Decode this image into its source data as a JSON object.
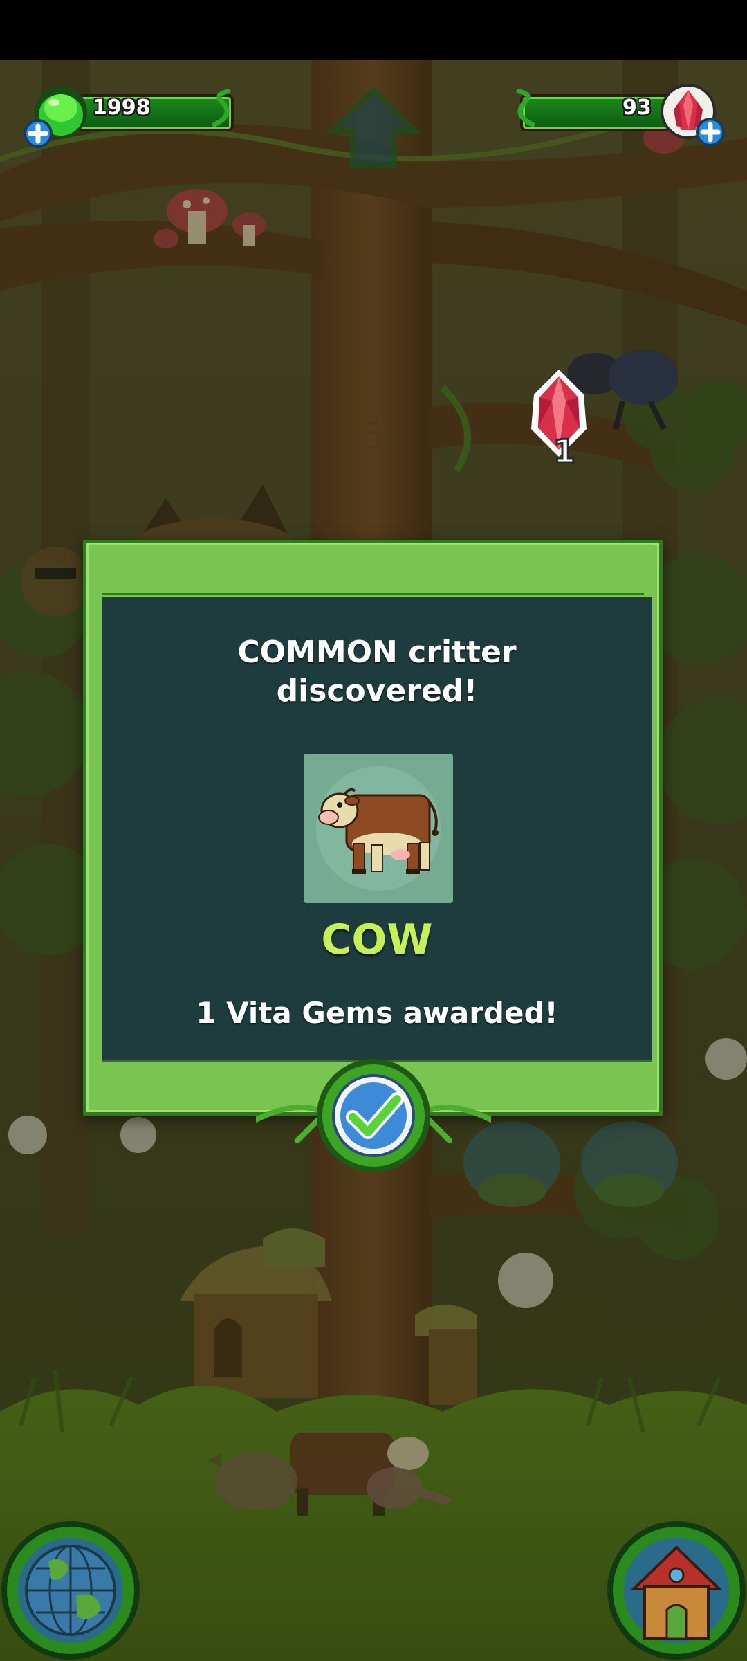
{
  "hud": {
    "green_currency": "1998",
    "gem_currency": "93"
  },
  "scene": {
    "tree_level_marker": "5",
    "gem_reward_count": "1"
  },
  "dialog": {
    "title_line1": "COMMON critter",
    "title_line2": "discovered!",
    "critter_name": "COW",
    "reward_text": "1 Vita Gems awarded!"
  },
  "colors": {
    "dialog_frame": "#7ac452",
    "dialog_panel": "#1e3c3e",
    "critter_name": "#c6f05a",
    "hud_bar": "#1c8a1c"
  },
  "icons": {
    "green_currency": "green-gumdrop-icon",
    "gem_currency": "red-gem-icon",
    "add": "plus-icon",
    "up": "up-arrow-icon",
    "confirm": "checkmark-icon",
    "world": "globe-icon",
    "home": "house-icon"
  }
}
